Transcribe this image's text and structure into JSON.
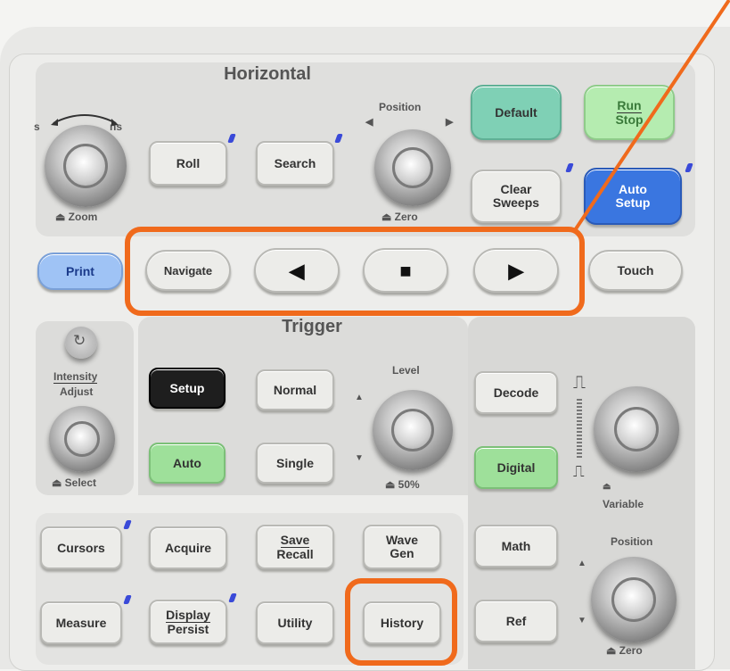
{
  "horizontal": {
    "title": "Horizontal",
    "scale_left": "s",
    "scale_right": "ns",
    "zoom_label": "Zoom",
    "roll": "Roll",
    "search": "Search",
    "position_label": "Position",
    "zero_label": "Zero"
  },
  "top_right": {
    "default": "Default",
    "run": "Run",
    "stop": "Stop",
    "clear_line1": "Clear",
    "clear_line2": "Sweeps",
    "auto_line1": "Auto",
    "auto_line2": "Setup"
  },
  "nav_row": {
    "print": "Print",
    "navigate": "Navigate",
    "back_icon": "◀",
    "stop_icon": "■",
    "play_icon": "▶",
    "touch": "Touch"
  },
  "intensity": {
    "line1": "Intensity",
    "line2": "Adjust",
    "select": "Select"
  },
  "trigger": {
    "title": "Trigger",
    "setup": "Setup",
    "normal": "Normal",
    "level_label": "Level",
    "auto": "Auto",
    "single": "Single",
    "fifty": "50%"
  },
  "right_panel": {
    "decode": "Decode",
    "digital": "Digital",
    "variable": "Variable",
    "math": "Math",
    "position_label": "Position",
    "ref": "Ref",
    "zero_label": "Zero"
  },
  "lower": {
    "cursors": "Cursors",
    "acquire": "Acquire",
    "save": "Save",
    "recall": "Recall",
    "wave": "Wave",
    "gen": "Gen",
    "measure": "Measure",
    "display": "Display",
    "persist": "Persist",
    "utility": "Utility",
    "history": "History"
  },
  "colors": {
    "highlight": "#f06a1c",
    "green_button": "#9ee09a",
    "blue_button": "#3a76e0",
    "teal_button": "#7fd0b5"
  }
}
